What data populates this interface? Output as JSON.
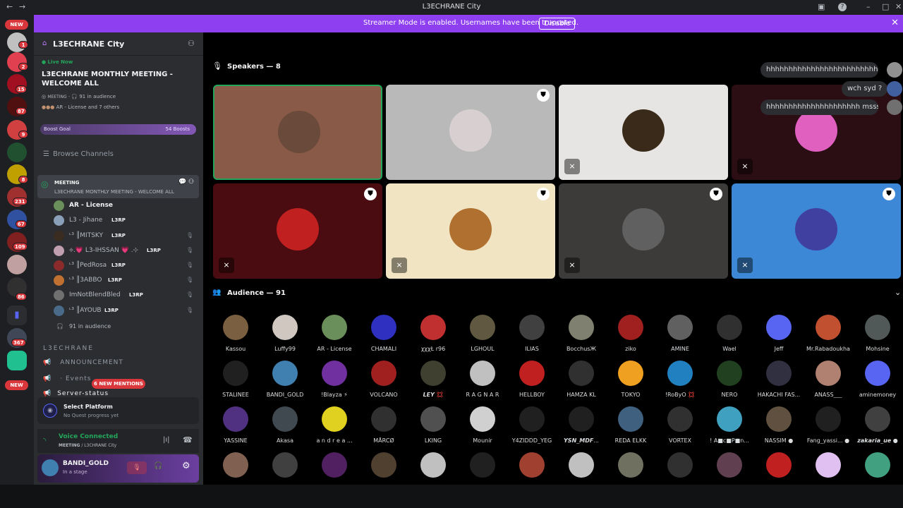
{
  "window": {
    "title": "L3ECHRANE City"
  },
  "banner": {
    "text": "Streamer Mode is enabled. Usernames have been truncated.",
    "button": "Disable"
  },
  "rail": {
    "new_top": "NEW",
    "new_bottom": "NEW",
    "badges": [
      "1",
      "2",
      "15",
      "87",
      "9",
      "8",
      "231",
      "67",
      "109",
      "86",
      "367"
    ]
  },
  "server": {
    "name": "L3ECHRANE City"
  },
  "event": {
    "live": "Live Now",
    "title": "L3ECHRANE MONTHLY MEETING - WELCOME ALL",
    "channel": "MEETING",
    "audience": "91 in audience",
    "speakers": "AR - License and 7 others"
  },
  "boost": {
    "label": "Boost Goal",
    "count": "54 Boosts"
  },
  "browse": "Browse Channels",
  "stage_channel": {
    "name": "MEETING",
    "topic": "L3ECHRANE MONTHLY MEETING - WELCOME ALL"
  },
  "members": [
    {
      "name": "AR - License",
      "tag": "",
      "color": "#6b8f5a"
    },
    {
      "name": "L3 - Jihane",
      "tag": "L3RP",
      "color": "#8aa0b8"
    },
    {
      "name": "ᶫ³ ║MITSKY",
      "tag": "L3RP",
      "color": "#3a2c20"
    },
    {
      "name": "⟡.💗 L3-IHSSAN 💗 .⊹",
      "tag": "L3RP",
      "color": "#c0a0b0"
    },
    {
      "name": "ᶫ³ ║PedRosa",
      "tag": "L3RP",
      "color": "#8a2a2a"
    },
    {
      "name": "ᶫ³ ║3ABBO",
      "tag": "L3RP",
      "color": "#c07030"
    },
    {
      "name": "ImNotBlendBled",
      "tag": "L3RP",
      "color": "#707070"
    },
    {
      "name": "ᶫ³ ║AYOUB",
      "tag": "L3RP",
      "color": "#4a6a8a"
    }
  ],
  "audience_summary": "91 in audience",
  "category": "L3ECHRANE",
  "channels": [
    "ANNOUNCEMENT",
    "Events",
    "Server-status"
  ],
  "new_mentions": "6 NEW MENTIONS",
  "quest": {
    "title": "Select Platform",
    "sub": "No Quest progress yet"
  },
  "voice": {
    "status": "Voice Connected",
    "channel": "MEETING",
    "server": "/ L3CHRANE City"
  },
  "user": {
    "name": "BANDI_GOLD",
    "status": "In a stage"
  },
  "speakers_header": "Speakers — 8",
  "audience_header": "Audience — 91",
  "chat": [
    "hhhhhhhhhhhhhhhhhhhhhhhhhhhhhhh...",
    "wch syd ?",
    "hhhhhhhhhhhhhhhhhhhhh msssskiiin..."
  ],
  "audience": [
    {
      "name": "Kassou",
      "color": "#7a6040"
    },
    {
      "name": "Luffy99",
      "color": "#d0c8c0"
    },
    {
      "name": "AR - License",
      "color": "#6b8f5a"
    },
    {
      "name": "CHAMALI",
      "color": "#3030c0"
    },
    {
      "name": "χχχŁ r96",
      "color": "#c03030"
    },
    {
      "name": "LGHOUL",
      "color": "#605840"
    },
    {
      "name": "ILIAS",
      "color": "#404040"
    },
    {
      "name": "BocchusЖ",
      "color": "#808070"
    },
    {
      "name": "ziko",
      "color": "#a02020"
    },
    {
      "name": "AMINE",
      "color": "#606060"
    },
    {
      "name": "Wael",
      "color": "#303030"
    },
    {
      "name": "Jeff",
      "color": "#5865f2"
    },
    {
      "name": "Mr.Rabadoukha",
      "color": "#c05030"
    },
    {
      "name": "Mohsine",
      "color": "#505858"
    },
    {
      "name": "STALINEE",
      "color": "#202020"
    },
    {
      "name": "BANDI_GOLD",
      "color": "#4080b0"
    },
    {
      "name": "!Blayza ⚡",
      "color": "#7030a0"
    },
    {
      "name": "VOLCANO",
      "color": "#a02020"
    },
    {
      "name": "𝙇𝙀𝙔 💢",
      "color": "#404030"
    },
    {
      "name": "R A G N A R",
      "color": "#c0c0c0"
    },
    {
      "name": "HELLBOY",
      "color": "#c02020"
    },
    {
      "name": "HAMZA KL",
      "color": "#303030"
    },
    {
      "name": "TOKYO",
      "color": "#f0a020"
    },
    {
      "name": "!RoByO 💢",
      "color": "#2080c0"
    },
    {
      "name": "NERO",
      "color": "#204020"
    },
    {
      "name": "HAKACHI FAS...",
      "color": "#303040"
    },
    {
      "name": "ANASS___",
      "color": "#b08070"
    },
    {
      "name": "aminemoney",
      "color": "#5865f2"
    },
    {
      "name": "YASSINE",
      "color": "#503080"
    },
    {
      "name": "Akasa",
      "color": "#404850"
    },
    {
      "name": "a n d r e a ...",
      "color": "#e0d020"
    },
    {
      "name": "MĀRCØ",
      "color": "#303030"
    },
    {
      "name": "LKING",
      "color": "#505050"
    },
    {
      "name": "Mounir",
      "color": "#d0d0d0"
    },
    {
      "name": "Y4ZIDDD_YEG",
      "color": "#202020"
    },
    {
      "name": "𝙔𝙎𝙉_𝙈𝘿𝙁...",
      "color": "#202020"
    },
    {
      "name": "REDA ELKK",
      "color": "#406080"
    },
    {
      "name": "VORTEX",
      "color": "#303030"
    },
    {
      "name": "! A■c■P■n...",
      "color": "#40a0c0"
    },
    {
      "name": "NASSIM ●",
      "color": "#605040"
    },
    {
      "name": "Fang_yassi... ●",
      "color": "#202020"
    },
    {
      "name": "𝙯𝙖𝙠𝙖𝙧𝙞𝙖_𝙪𝙚 ●",
      "color": "#404040"
    },
    {
      "name": "",
      "color": "#806050"
    },
    {
      "name": "",
      "color": "#404040"
    },
    {
      "name": "",
      "color": "#502060"
    },
    {
      "name": "",
      "color": "#504030"
    },
    {
      "name": "",
      "color": "#c0c0c0"
    },
    {
      "name": "",
      "color": "#202020"
    },
    {
      "name": "",
      "color": "#a04030"
    },
    {
      "name": "",
      "color": "#c0c0c0"
    },
    {
      "name": "",
      "color": "#707060"
    },
    {
      "name": "",
      "color": "#303030"
    },
    {
      "name": "",
      "color": "#604050"
    },
    {
      "name": "",
      "color": "#c02020"
    },
    {
      "name": "",
      "color": "#e0c0f0"
    },
    {
      "name": "",
      "color": "#40a080"
    }
  ],
  "tile_colors": [
    "#8a5a48",
    "#b9b9b9",
    "#e7e5e3",
    "#2b0d14",
    "#4a0c10",
    "#f1e4c2",
    "#3d3b3a",
    "#3c88d6"
  ],
  "tile_avatar_colors": [
    "#6a4a3a",
    "#d8d0d0",
    "#3a2a1a",
    "#e060c0",
    "#c02020",
    "#b07030",
    "#606060",
    "#4040a0"
  ]
}
